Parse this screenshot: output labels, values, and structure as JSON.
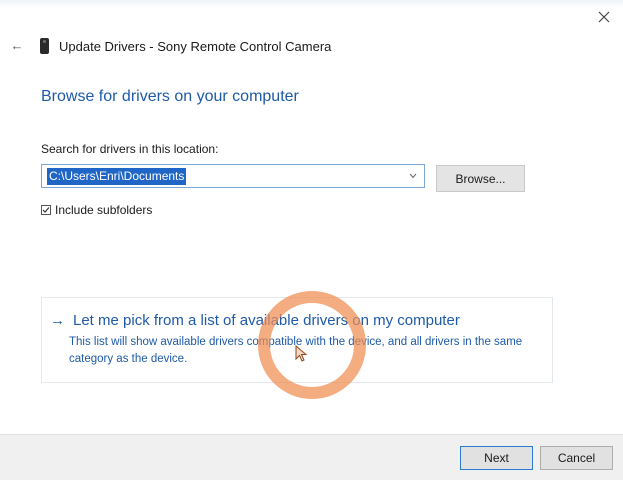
{
  "window": {
    "title": "Update Drivers - Sony Remote Control Camera",
    "close_icon": "close-icon",
    "back_icon": "back-arrow-icon",
    "device_icon": "phone-device-icon"
  },
  "main": {
    "heading": "Browse for drivers on your computer",
    "search_label": "Search for drivers in this location:",
    "path_value": "C:\\Users\\Enri\\Documents",
    "browse_label": "Browse...",
    "include_subfolders_label": "Include subfolders",
    "include_subfolders_checked": true
  },
  "pick": {
    "arrow": "→",
    "title": "Let me pick from a list of available drivers on my computer",
    "description": "This list will show available drivers compatible with the device, and all drivers in the same category as the device."
  },
  "footer": {
    "next_label": "Next",
    "cancel_label": "Cancel"
  },
  "colors": {
    "accent": "#1e5aa8",
    "selection": "#1f66c7",
    "cursor_highlight": "#f08c50"
  }
}
